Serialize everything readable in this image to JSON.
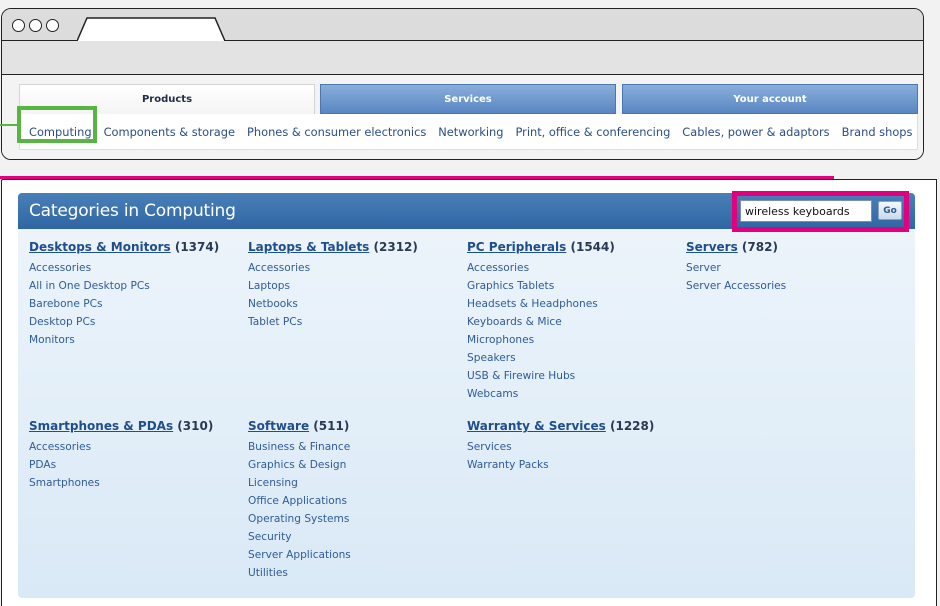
{
  "nav": {
    "tabs": [
      {
        "label": "Products"
      },
      {
        "label": "Services"
      },
      {
        "label": "Your account"
      }
    ],
    "subnav": [
      "Computing",
      "Components & storage",
      "Phones & consumer electronics",
      "Networking",
      "Print, office & conferencing",
      "Cables, power & adaptors",
      "Brand shops"
    ]
  },
  "panel": {
    "title": "Categories in Computing",
    "search_value": "wireless keyboards",
    "go_label": "Go"
  },
  "categories": [
    {
      "name": "Desktops & Monitors",
      "count": "(1374)",
      "items": [
        "Accessories",
        "All in One Desktop PCs",
        "Barebone PCs",
        "Desktop PCs",
        "Monitors"
      ]
    },
    {
      "name": "Laptops & Tablets",
      "count": "(2312)",
      "items": [
        "Accessories",
        "Laptops",
        "Netbooks",
        "Tablet PCs"
      ]
    },
    {
      "name": "PC Peripherals",
      "count": "(1544)",
      "items": [
        "Accessories",
        "Graphics Tablets",
        "Headsets & Headphones",
        "Keyboards & Mice",
        "Microphones",
        "Speakers",
        "USB & Firewire Hubs",
        "Webcams"
      ]
    },
    {
      "name": "Servers",
      "count": "(782)",
      "items": [
        "Server",
        "Server Accessories"
      ]
    },
    {
      "name": "Smartphones & PDAs",
      "count": "(310)",
      "items": [
        "Accessories",
        "PDAs",
        "Smartphones"
      ]
    },
    {
      "name": "Software",
      "count": "(511)",
      "items": [
        "Business & Finance",
        "Graphics & Design",
        "Licensing",
        "Office Applications",
        "Operating Systems",
        "Security",
        "Server Applications",
        "Utilities"
      ]
    },
    {
      "name": "Warranty & Services",
      "count": "(1228)",
      "items": [
        "Services",
        "Warranty Packs"
      ]
    }
  ]
}
